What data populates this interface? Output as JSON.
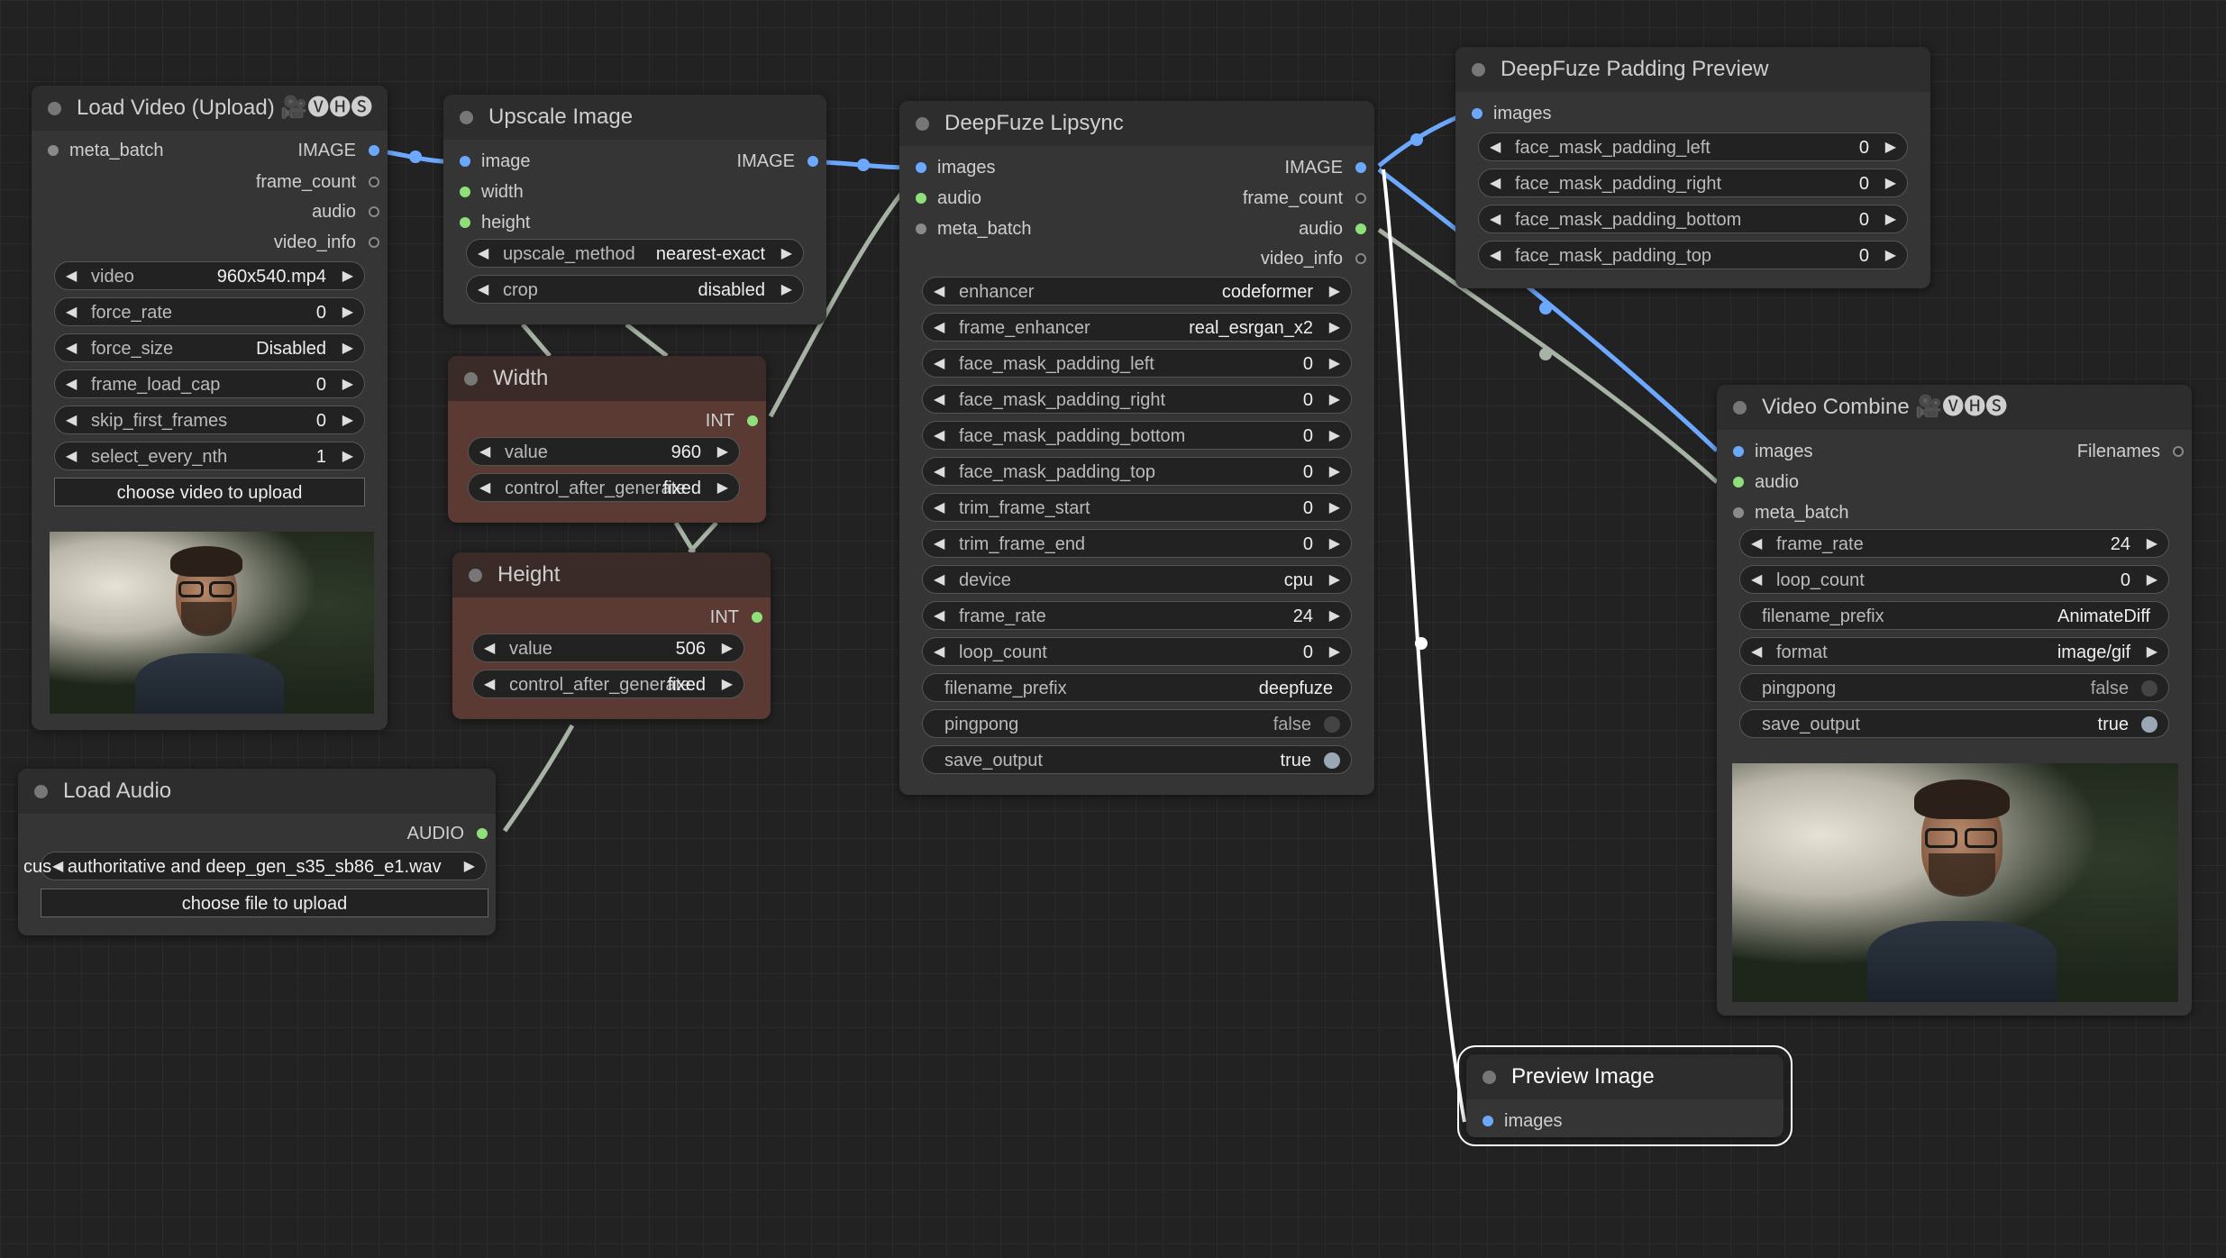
{
  "load_video": {
    "title": "Load Video (Upload) 🎥🅥🅗🅢",
    "inputs": [
      "meta_batch"
    ],
    "outputs": [
      "IMAGE",
      "frame_count",
      "audio",
      "video_info"
    ],
    "widgets": [
      {
        "label": "video",
        "value": "960x540.mp4"
      },
      {
        "label": "force_rate",
        "value": "0"
      },
      {
        "label": "force_size",
        "value": "Disabled"
      },
      {
        "label": "frame_load_cap",
        "value": "0"
      },
      {
        "label": "skip_first_frames",
        "value": "0"
      },
      {
        "label": "select_every_nth",
        "value": "1"
      }
    ],
    "upload_button": "choose video to upload"
  },
  "upscale_image": {
    "title": "Upscale Image",
    "inputs": [
      "image",
      "width",
      "height"
    ],
    "output": "IMAGE",
    "widgets": [
      {
        "label": "upscale_method",
        "value": "nearest-exact"
      },
      {
        "label": "crop",
        "value": "disabled"
      }
    ]
  },
  "width_node": {
    "title": "Width",
    "output": "INT",
    "widgets": [
      {
        "label": "value",
        "value": "960"
      },
      {
        "label": "control_after_generate",
        "value": "fixed"
      }
    ]
  },
  "height_node": {
    "title": "Height",
    "output": "INT",
    "widgets": [
      {
        "label": "value",
        "value": "506"
      },
      {
        "label": "control_after_generate",
        "value": "fixed"
      }
    ]
  },
  "load_audio": {
    "title": "Load Audio",
    "output": "AUDIO",
    "file_value": "cus - authoritative and deep_gen_s35_sb86_e1.wav",
    "upload_button": "choose file to upload"
  },
  "lipsync": {
    "title": "DeepFuze Lipsync",
    "inputs": [
      "images",
      "audio",
      "meta_batch"
    ],
    "outputs": [
      "IMAGE",
      "frame_count",
      "audio",
      "video_info"
    ],
    "widgets": [
      {
        "label": "enhancer",
        "value": "codeformer"
      },
      {
        "label": "frame_enhancer",
        "value": "real_esrgan_x2"
      },
      {
        "label": "face_mask_padding_left",
        "value": "0"
      },
      {
        "label": "face_mask_padding_right",
        "value": "0"
      },
      {
        "label": "face_mask_padding_bottom",
        "value": "0"
      },
      {
        "label": "face_mask_padding_top",
        "value": "0"
      },
      {
        "label": "trim_frame_start",
        "value": "0"
      },
      {
        "label": "trim_frame_end",
        "value": "0"
      },
      {
        "label": "device",
        "value": "cpu"
      },
      {
        "label": "frame_rate",
        "value": "24"
      },
      {
        "label": "loop_count",
        "value": "0"
      }
    ],
    "filename_prefix": {
      "label": "filename_prefix",
      "value": "deepfuze"
    },
    "pingpong": {
      "label": "pingpong",
      "value": "false"
    },
    "save_output": {
      "label": "save_output",
      "value": "true"
    }
  },
  "padding_preview": {
    "title": "DeepFuze Padding Preview",
    "inputs": [
      "images"
    ],
    "widgets": [
      {
        "label": "face_mask_padding_left",
        "value": "0"
      },
      {
        "label": "face_mask_padding_right",
        "value": "0"
      },
      {
        "label": "face_mask_padding_bottom",
        "value": "0"
      },
      {
        "label": "face_mask_padding_top",
        "value": "0"
      }
    ]
  },
  "video_combine": {
    "title": "Video Combine 🎥🅥🅗🅢",
    "inputs": [
      "images",
      "audio",
      "meta_batch"
    ],
    "output": "Filenames",
    "widgets": [
      {
        "label": "frame_rate",
        "value": "24"
      },
      {
        "label": "loop_count",
        "value": "0"
      }
    ],
    "filename_prefix": {
      "label": "filename_prefix",
      "value": "AnimateDiff"
    },
    "format": {
      "label": "format",
      "value": "image/gif"
    },
    "pingpong": {
      "label": "pingpong",
      "value": "false"
    },
    "save_output": {
      "label": "save_output",
      "value": "true"
    }
  },
  "preview_image": {
    "title": "Preview Image",
    "inputs": [
      "images"
    ]
  },
  "colors": {
    "canvas": "#222222",
    "node": "#353535",
    "primitive_node": "#5a3a32",
    "image_link": "#6da8ff",
    "audio_link": "#8fe07a",
    "other_link": "#a7b3a5"
  }
}
